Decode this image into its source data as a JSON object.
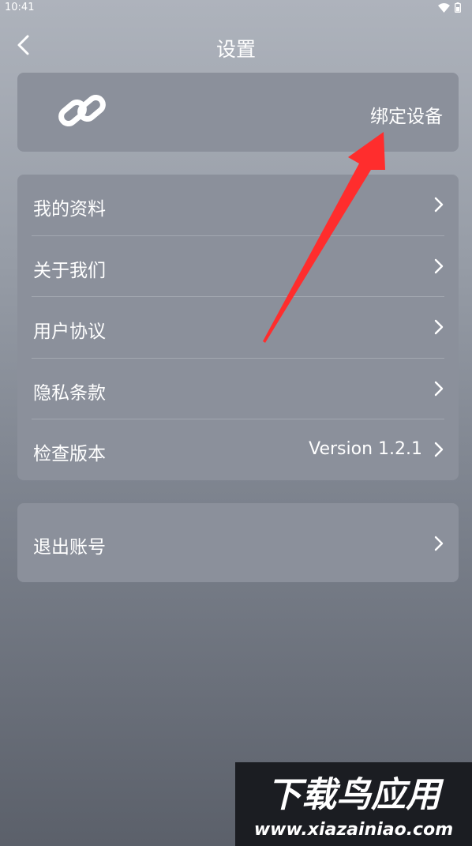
{
  "status_bar": {
    "time": "10:41",
    "icons": [
      "wifi-icon",
      "battery-icon"
    ]
  },
  "header": {
    "title": "设置",
    "back_icon": "chevron-left-icon"
  },
  "bind_device": {
    "icon": "link-icon",
    "label": "绑定设备"
  },
  "menu": {
    "items": [
      {
        "label": "我的资料",
        "value": ""
      },
      {
        "label": "关于我们",
        "value": ""
      },
      {
        "label": "用户协议",
        "value": ""
      },
      {
        "label": "隐私条款",
        "value": ""
      },
      {
        "label": "检查版本",
        "value": "Version 1.2.1"
      }
    ]
  },
  "logout": {
    "label": "退出账号"
  },
  "watermark": {
    "title": "下载鸟应用",
    "url": "www.xiazainiao.com"
  },
  "colors": {
    "card": "#8b909b",
    "annotation_arrow": "#ff2d2d",
    "text": "#ffffff"
  }
}
